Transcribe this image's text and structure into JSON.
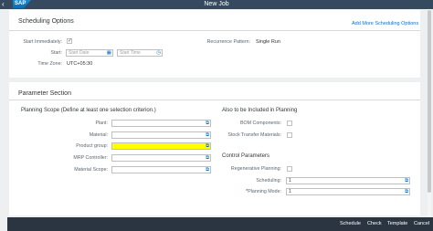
{
  "shell": {
    "logo": "SAP",
    "title": "New Job",
    "back": "‹"
  },
  "scheduling": {
    "title": "Scheduling Options",
    "add_more_link": "Add More Scheduling Options",
    "start_immediately_label": "Start Immediately:",
    "start_immediately_checked": true,
    "start_label": "Start:",
    "start_date_placeholder": "Start Date",
    "start_time_placeholder": "Start Time",
    "timezone_label": "Time Zone:",
    "timezone_value": "UTC+05:30",
    "recurrence_label": "Recurrence Pattern:",
    "recurrence_value": "Single Run"
  },
  "parameters": {
    "title": "Parameter Section",
    "scope_heading": "Planning Scope (Define at least one selection criterion.)",
    "fields": [
      {
        "label": "Plant:",
        "value": ""
      },
      {
        "label": "Material:",
        "value": ""
      },
      {
        "label": "Product group:",
        "value": ""
      },
      {
        "label": "MRP Controller:",
        "value": ""
      },
      {
        "label": "Material Scope:",
        "value": ""
      }
    ],
    "also_heading": "Also to be Included in Planning",
    "bom_label": "BOM Components:",
    "stock_label": "Stock Transfer Materials:",
    "control_heading": "Control Parameters",
    "regen_label": "Regenerative Planning:",
    "scheduling_label": "Scheduling:",
    "scheduling_value": "1",
    "planning_mode_required": "*",
    "planning_mode_label": "Planning Mode:",
    "planning_mode_value": "1"
  },
  "footer": {
    "schedule": "Schedule",
    "check": "Check",
    "template": "Template",
    "cancel": "Cancel"
  },
  "colors": {
    "shell": "#354a5f",
    "footer": "#2b3541",
    "link": "#0a6ed1",
    "highlight": "#ffff00"
  }
}
